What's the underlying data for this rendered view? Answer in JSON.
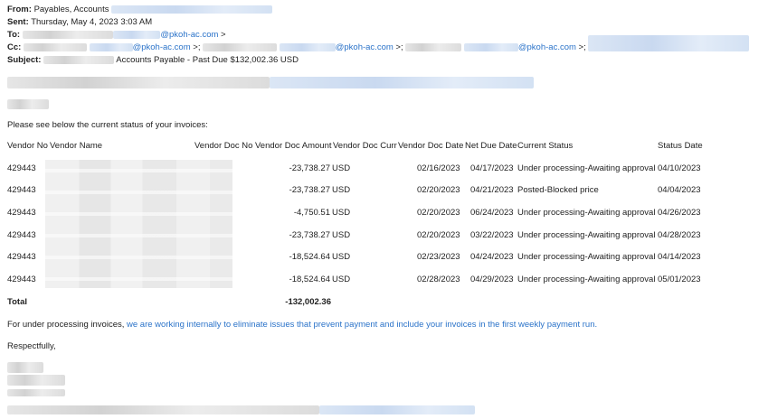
{
  "email": {
    "from_label": "From:",
    "from_value": "Payables, Accounts",
    "sent_label": "Sent:",
    "sent_value": "Thursday, May 4, 2023 3:03 AM",
    "to_label": "To:",
    "to_domain": "@pkoh-ac.com",
    "to_suffix": ">",
    "cc_label": "Cc:",
    "cc_domain_1": "@pkoh-ac.com",
    "cc_sep_1": ">;",
    "cc_domain_2": "@pkoh-ac.com",
    "cc_sep_2": ">;",
    "cc_domain_3": "@pkoh-ac.com",
    "cc_sep_3": ">;",
    "subject_label": "Subject:",
    "subject_value": "Accounts Payable - Past Due $132,002.36 USD"
  },
  "body": {
    "intro": "Please see below the current status of your invoices:",
    "footer_plain": "For under processing invoices,",
    "footer_link": "we are working internally to eliminate issues that prevent payment and include your invoices in the first weekly payment run.",
    "closing": "Respectfully,"
  },
  "table": {
    "headers": {
      "vendor_no": "Vendor No",
      "vendor_name": "Vendor Name",
      "vendor_doc_no": "Vendor Doc No",
      "vendor_doc_amount": "Vendor Doc Amount",
      "vendor_doc_curr": "Vendor Doc Curr",
      "vendor_doc_date": "Vendor Doc Date",
      "net_due_date": "Net Due Date",
      "current_status": "Current Status",
      "status_date": "Status Date"
    },
    "rows": [
      {
        "vendor_no": "429443",
        "amount": "-23,738.27",
        "curr": "USD",
        "doc_date": "02/16/2023",
        "due_date": "04/17/2023",
        "status": "Under processing-Awaiting approval",
        "status_date": "04/10/2023"
      },
      {
        "vendor_no": "429443",
        "amount": "-23,738.27",
        "curr": "USD",
        "doc_date": "02/20/2023",
        "due_date": "04/21/2023",
        "status": "Posted-Blocked price",
        "status_date": "04/04/2023"
      },
      {
        "vendor_no": "429443",
        "amount": "-4,750.51",
        "curr": "USD",
        "doc_date": "02/20/2023",
        "due_date": "06/24/2023",
        "status": "Under processing-Awaiting approval",
        "status_date": "04/26/2023"
      },
      {
        "vendor_no": "429443",
        "amount": "-23,738.27",
        "curr": "USD",
        "doc_date": "02/20/2023",
        "due_date": "03/22/2023",
        "status": "Under processing-Awaiting approval",
        "status_date": "04/28/2023"
      },
      {
        "vendor_no": "429443",
        "amount": "-18,524.64",
        "curr": "USD",
        "doc_date": "02/23/2023",
        "due_date": "04/24/2023",
        "status": "Under processing-Awaiting approval",
        "status_date": "04/14/2023"
      },
      {
        "vendor_no": "429443",
        "amount": "-18,524.64",
        "curr": "USD",
        "doc_date": "02/28/2023",
        "due_date": "04/29/2023",
        "status": "Under processing-Awaiting approval",
        "status_date": "05/01/2023"
      }
    ],
    "total_label": "Total",
    "total_value": "-132,002.36"
  }
}
